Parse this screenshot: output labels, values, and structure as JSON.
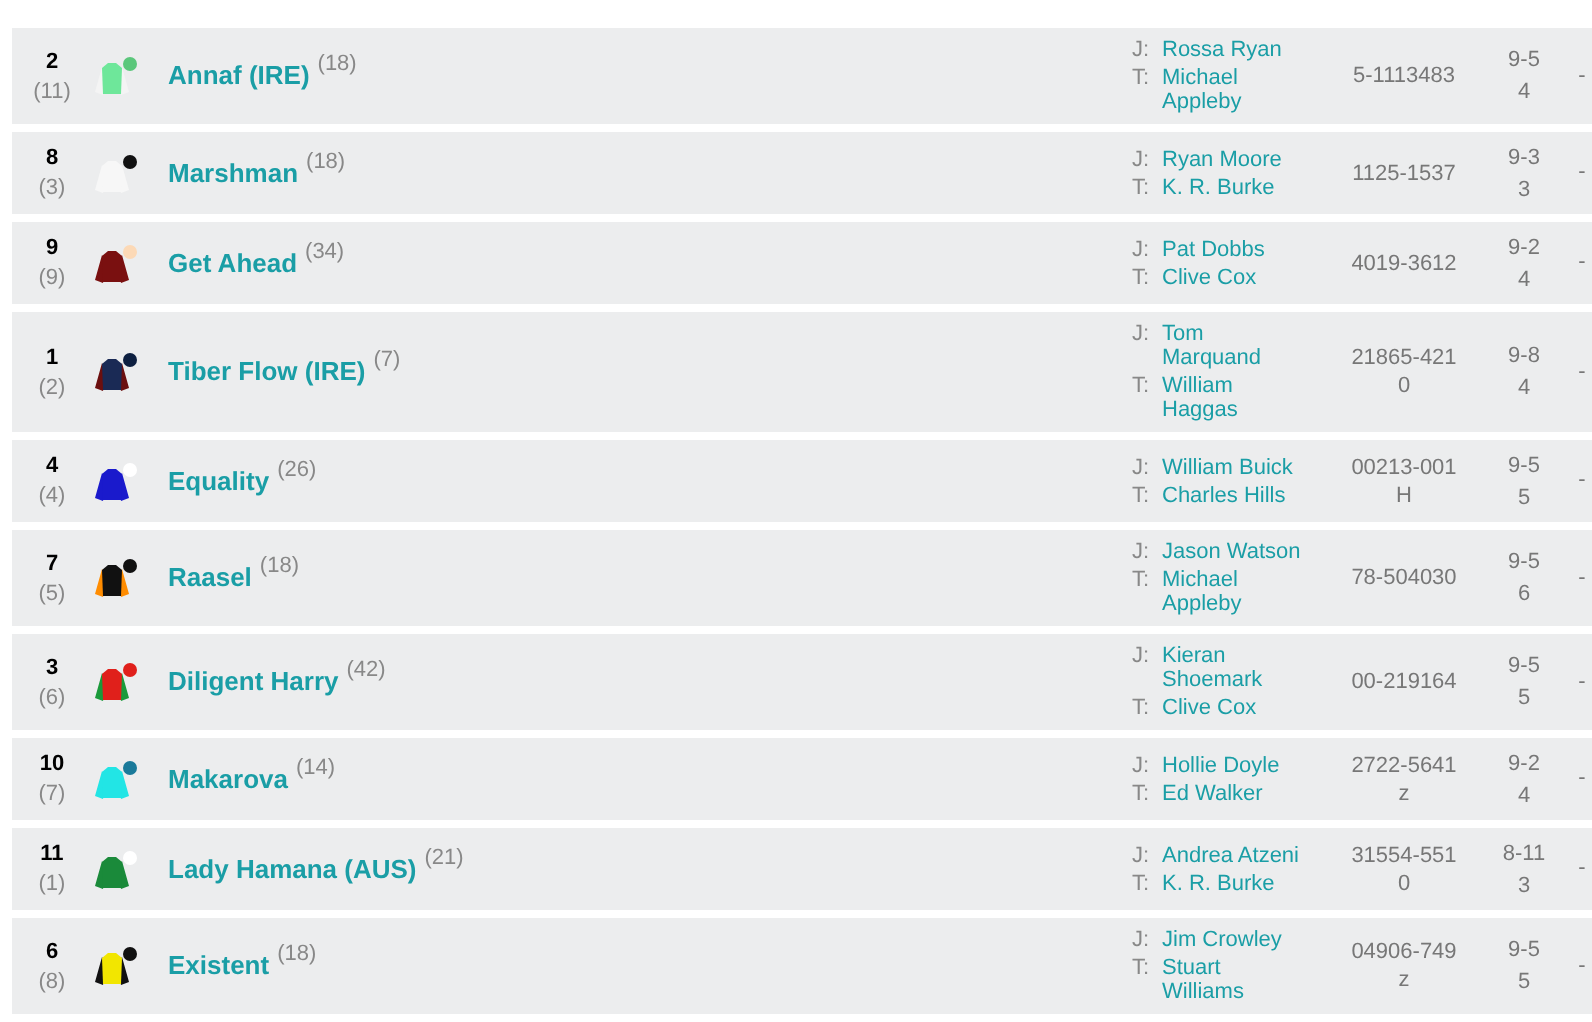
{
  "runners": [
    {
      "number": "2",
      "draw": "(11)",
      "horse": "Annaf (IRE)",
      "rating": "(18)",
      "jockey_label": "J:",
      "jockey": "Rossa Ryan",
      "trainer_label": "T:",
      "trainer": "Michael Appleby",
      "form": "5-1113483",
      "weight": "9-5",
      "age": "4",
      "column_6": "-",
      "silk": [
        {
          "kind": "sleeves",
          "color": "#f4f4f4"
        },
        {
          "kind": "body",
          "color": "#6ee79a"
        },
        {
          "kind": "cap",
          "color": "#5bc77b"
        }
      ]
    },
    {
      "number": "8",
      "draw": "(3)",
      "horse": "Marshman",
      "rating": "(18)",
      "jockey_label": "J:",
      "jockey": "Ryan Moore",
      "trainer_label": "T:",
      "trainer": "K. R. Burke",
      "form": "1125-1537",
      "weight": "9-3",
      "age": "3",
      "column_6": "-",
      "silk": [
        {
          "kind": "sleeves",
          "color": "#f7f7f7"
        },
        {
          "kind": "body",
          "color": "#f7f7f7"
        },
        {
          "kind": "cap",
          "color": "#111111"
        }
      ]
    },
    {
      "number": "9",
      "draw": "(9)",
      "horse": "Get Ahead",
      "rating": "(34)",
      "jockey_label": "J:",
      "jockey": "Pat Dobbs",
      "trainer_label": "T:",
      "trainer": "Clive Cox",
      "form": "4019-3612",
      "weight": "9-2",
      "age": "4",
      "column_6": "-",
      "silk": [
        {
          "kind": "sleeves",
          "color": "#7a1010"
        },
        {
          "kind": "body",
          "color": "#7a1010"
        },
        {
          "kind": "cap",
          "color": "#fcd9b6"
        }
      ]
    },
    {
      "number": "1",
      "draw": "(2)",
      "horse": "Tiber Flow (IRE)",
      "rating": "(7)",
      "jockey_label": "J:",
      "jockey": "Tom Marquand",
      "trainer_label": "T:",
      "trainer": "William Haggas",
      "form": "21865-4210",
      "weight": "9-8",
      "age": "4",
      "column_6": "-",
      "silk": [
        {
          "kind": "sleeves",
          "color": "#6b0f0f"
        },
        {
          "kind": "body",
          "color": "#1a2a55"
        },
        {
          "kind": "cap",
          "color": "#0d1f40"
        }
      ]
    },
    {
      "number": "4",
      "draw": "(4)",
      "horse": "Equality",
      "rating": "(26)",
      "jockey_label": "J:",
      "jockey": "William Buick",
      "trainer_label": "T:",
      "trainer": "Charles Hills",
      "form": "00213-001H",
      "weight": "9-5",
      "age": "5",
      "column_6": "-",
      "silk": [
        {
          "kind": "sleeves",
          "color": "#1a1acc"
        },
        {
          "kind": "body",
          "color": "#1a1acc"
        },
        {
          "kind": "cap",
          "color": "#ffffff"
        }
      ]
    },
    {
      "number": "7",
      "draw": "(5)",
      "horse": "Raasel",
      "rating": "(18)",
      "jockey_label": "J:",
      "jockey": "Jason Watson",
      "trainer_label": "T:",
      "trainer": "Michael Appleby",
      "form": "78-504030",
      "weight": "9-5",
      "age": "6",
      "column_6": "-",
      "silk": [
        {
          "kind": "sleeves",
          "color": "#ff8c00"
        },
        {
          "kind": "body",
          "color": "#111111"
        },
        {
          "kind": "cap",
          "color": "#111111"
        }
      ]
    },
    {
      "number": "3",
      "draw": "(6)",
      "horse": "Diligent Harry",
      "rating": "(42)",
      "jockey_label": "J:",
      "jockey": "Kieran Shoemark",
      "trainer_label": "T:",
      "trainer": "Clive Cox",
      "form": "00-219164",
      "weight": "9-5",
      "age": "5",
      "column_6": "-",
      "silk": [
        {
          "kind": "sleeves",
          "color": "#1a9a3a"
        },
        {
          "kind": "body",
          "color": "#e0201b"
        },
        {
          "kind": "cap",
          "color": "#e0201b"
        }
      ]
    },
    {
      "number": "10",
      "draw": "(7)",
      "horse": "Makarova",
      "rating": "(14)",
      "jockey_label": "J:",
      "jockey": "Hollie Doyle",
      "trainer_label": "T:",
      "trainer": "Ed Walker",
      "form": "2722-5641z",
      "weight": "9-2",
      "age": "4",
      "column_6": "-",
      "silk": [
        {
          "kind": "sleeves",
          "color": "#22e5e5"
        },
        {
          "kind": "body",
          "color": "#22e5e5"
        },
        {
          "kind": "cap",
          "color": "#1a7a9a"
        }
      ]
    },
    {
      "number": "11",
      "draw": "(1)",
      "horse": "Lady Hamana (AUS)",
      "rating": "(21)",
      "jockey_label": "J:",
      "jockey": "Andrea Atzeni",
      "trainer_label": "T:",
      "trainer": "K. R. Burke",
      "form": "31554-5510",
      "weight": "8-11",
      "age": "3",
      "column_6": "-",
      "silk": [
        {
          "kind": "sleeves",
          "color": "#1a8a3a"
        },
        {
          "kind": "body",
          "color": "#1a8a3a"
        },
        {
          "kind": "cap",
          "color": "#ffffff"
        }
      ]
    },
    {
      "number": "6",
      "draw": "(8)",
      "horse": "Existent",
      "rating": "(18)",
      "jockey_label": "J:",
      "jockey": "Jim Crowley",
      "trainer_label": "T:",
      "trainer": "Stuart Williams",
      "form": "04906-749z",
      "weight": "9-5",
      "age": "5",
      "column_6": "-",
      "silk": [
        {
          "kind": "sleeves",
          "color": "#111111"
        },
        {
          "kind": "body",
          "color": "#f2e600"
        },
        {
          "kind": "cap",
          "color": "#111111"
        }
      ]
    }
  ]
}
